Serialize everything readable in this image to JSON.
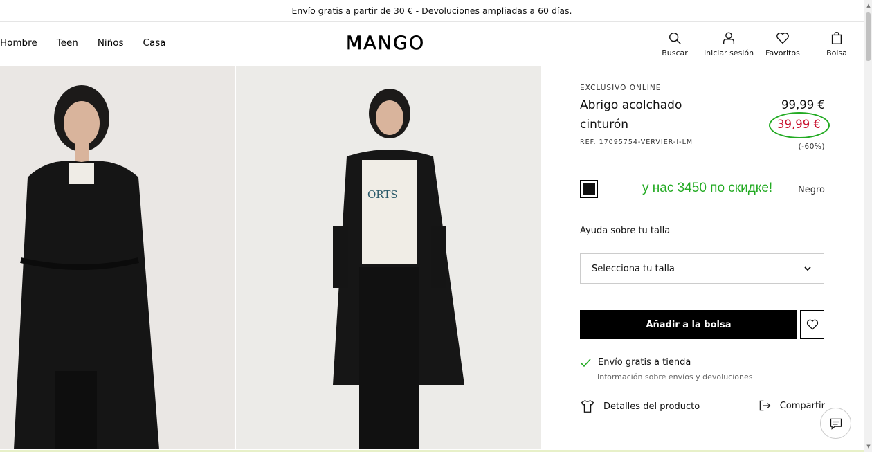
{
  "topbar": {
    "text": "Envío gratis a partir de 30 € - Devoluciones ampliadas a 60 días."
  },
  "nav": {
    "items": [
      "Hombre",
      "Teen",
      "Niños",
      "Casa"
    ]
  },
  "logo": {
    "text": "MANGO"
  },
  "actions": {
    "search": "Buscar",
    "login": "Iniciar sesión",
    "favorites": "Favoritos",
    "bag": "Bolsa"
  },
  "product": {
    "label": "EXCLUSIVO ONLINE",
    "title": "Abrigo acolchado cinturón",
    "ref": "REF. 17095754-VERVIER-I-LM",
    "old_price": "99,99 €",
    "new_price": "39,99 €",
    "discount": "(-60%)",
    "color_name": "Negro",
    "size_help": "Ayuda sobre tu talla",
    "size_placeholder": "Selecciona tu talla",
    "add_to_bag": "Añadir a la bolsa",
    "shipping": "Envío gratis a tienda",
    "shipping_info": "Información sobre envíos y devoluciones",
    "details": "Detalles del producto",
    "share": "Compartir"
  },
  "annotation": {
    "promo_text": "у нас 3450 по скидке!"
  },
  "colors": {
    "sale_red": "#c8102e",
    "annotation_green": "#22aa22",
    "black": "#000000"
  }
}
